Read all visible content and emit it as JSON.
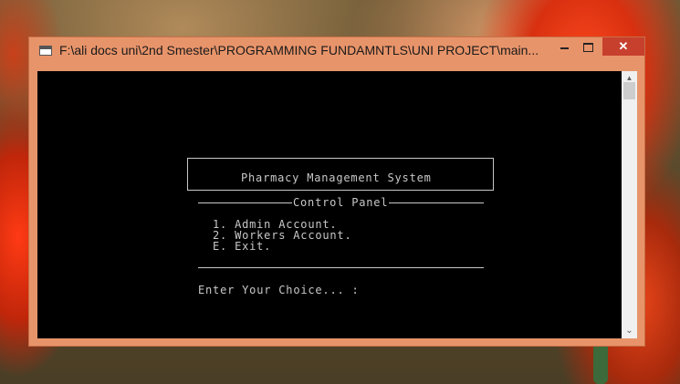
{
  "window": {
    "title": "F:\\ali docs uni\\2nd Smester\\PROGRAMMING FUNDAMNTLS\\UNI PROJECT\\main...",
    "controls": {
      "minimize": "minimize",
      "maximize": "maximize",
      "close": "✕"
    }
  },
  "console": {
    "heading": "Pharmacy Management System",
    "panel_title": "Control Panel",
    "menu": [
      "1. Admin Account.",
      "2. Workers Account.",
      "E. Exit."
    ],
    "prompt": "Enter Your Choice... :"
  },
  "scrollbar": {
    "up_icon": "▲",
    "down_icon": "⌄"
  },
  "colors": {
    "frame": "#e8946a",
    "close_button": "#c7402e",
    "console_bg": "#000000",
    "console_text": "#c8c8c8"
  }
}
